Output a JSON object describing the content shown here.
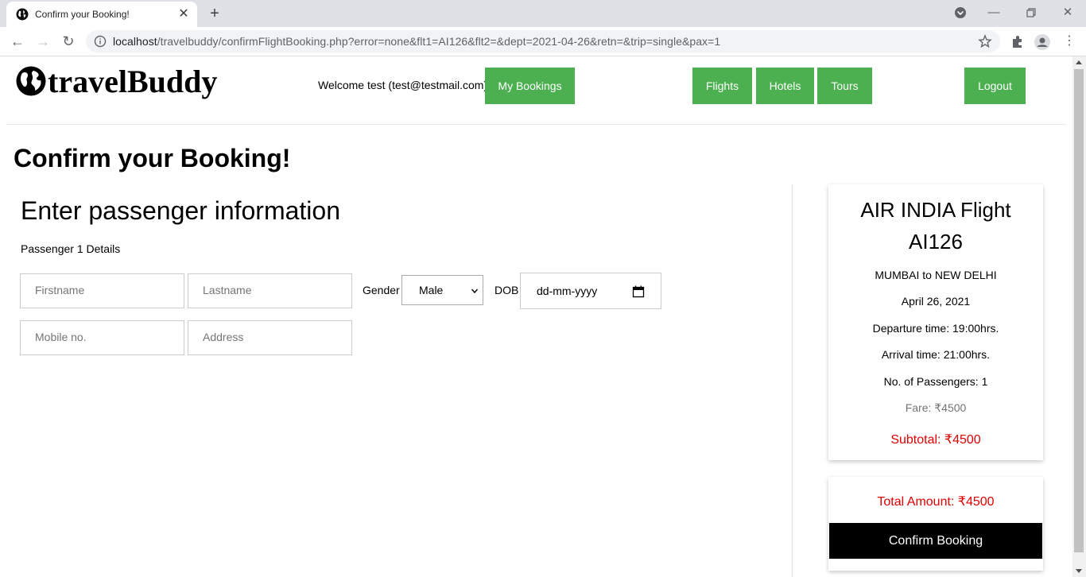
{
  "browser": {
    "tab_title": "Confirm your Booking!",
    "url_host": "localhost",
    "url_path": "/travelbuddy/confirmFlightBooking.php?error=none&flt1=AI126&flt2=&dept=2021-04-26&retn=&trip=single&pax=1"
  },
  "header": {
    "logo_text": "travelBuddy",
    "welcome": "Welcome test (test@testmail.com)",
    "nav": {
      "my_bookings": "My Bookings",
      "flights": "Flights",
      "hotels": "Hotels",
      "tours": "Tours",
      "logout": "Logout"
    },
    "accent_color": "#4caf50"
  },
  "page_title": "Confirm your Booking!",
  "form": {
    "section_title": "Enter passenger information",
    "passenger_label": "Passenger 1 Details",
    "firstname_placeholder": "Firstname",
    "lastname_placeholder": "Lastname",
    "gender_label": "Gender",
    "gender_value": "Male",
    "dob_label": "DOB",
    "dob_placeholder": "dd-mm-yyyy",
    "mobile_placeholder": "Mobile no.",
    "address_placeholder": "Address"
  },
  "summary": {
    "title_line1": "AIR INDIA Flight",
    "title_line2": "AI126",
    "route": "MUMBAI to NEW DELHI",
    "date": "April 26, 2021",
    "departure": "Departure time: 19:00hrs.",
    "arrival": "Arrival time: 21:00hrs.",
    "passengers": "No. of Passengers: 1",
    "fare": "Fare: ₹4500",
    "subtotal": "Subtotal: ₹4500"
  },
  "total": {
    "amount": "Total Amount: ₹4500",
    "confirm_label": "Confirm Booking",
    "highlight_color": "#e00000"
  }
}
